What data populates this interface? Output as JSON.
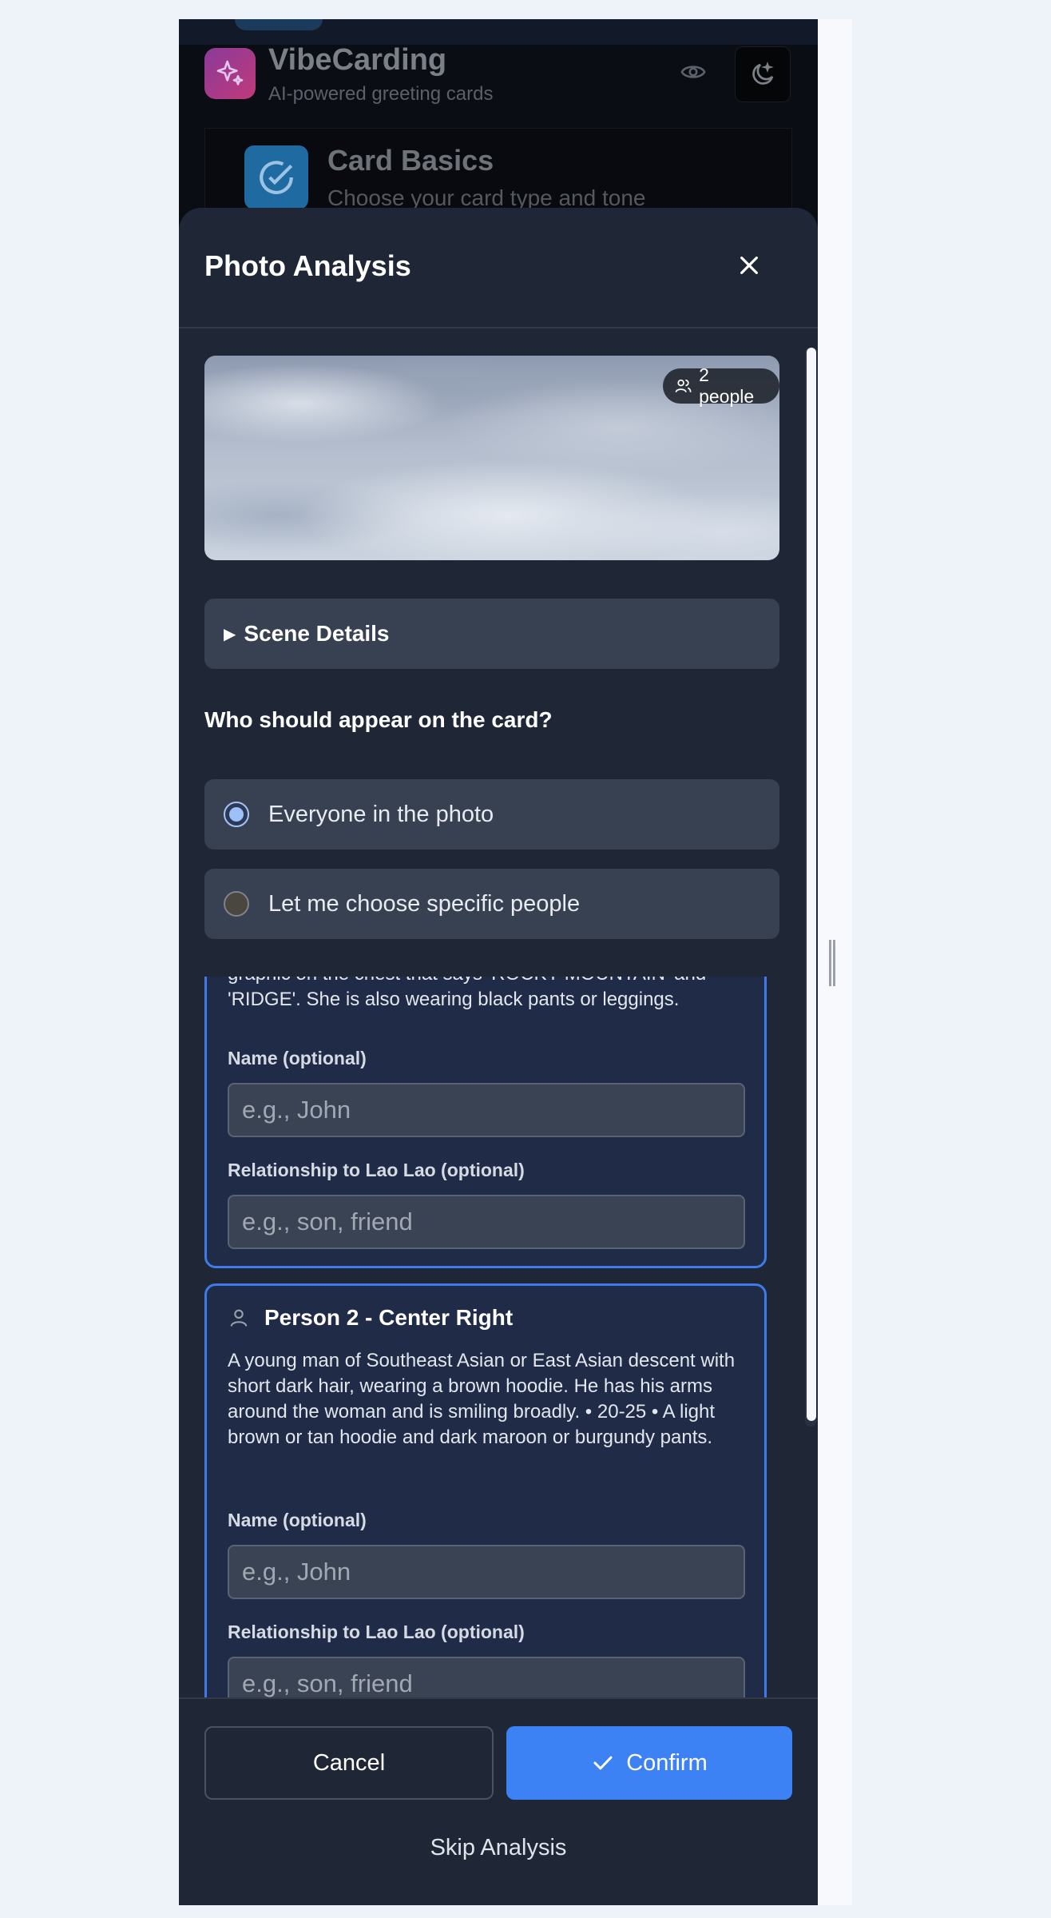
{
  "header": {
    "app_name": "VibeCarding",
    "tagline": "AI-powered greeting cards",
    "icons": [
      "sparkles-icon",
      "eye-icon",
      "moon-icon"
    ]
  },
  "background_section": {
    "title": "Card Basics",
    "subtitle": "Choose your card type and tone",
    "icon": "check-circle-icon"
  },
  "modal": {
    "title": "Photo Analysis",
    "people_badge": "2 people",
    "scene_details": "Scene Details",
    "who_question": "Who should appear on the card?",
    "options": [
      {
        "label": "Everyone in the photo",
        "selected": true
      },
      {
        "label": "Let me choose specific people",
        "selected": false
      }
    ],
    "people": [
      {
        "title": "",
        "description_visible": "graphic on the chest that says 'ROCKY MOUNTAIN' and 'RIDGE'. She is also wearing black pants or leggings.",
        "name_label": "Name (optional)",
        "name_placeholder": "e.g., John",
        "relationship_label": "Relationship to Lao Lao (optional)",
        "relationship_placeholder": "e.g., son, friend"
      },
      {
        "title": "Person 2 - Center Right",
        "description_visible": "A young man of Southeast Asian or East Asian descent with short dark hair, wearing a brown hoodie. He has his arms around the woman and is smiling broadly. • 20-25 • A light brown or tan hoodie and dark maroon or burgundy pants.",
        "name_label": "Name (optional)",
        "name_placeholder": "e.g., John",
        "relationship_label": "Relationship to Lao Lao (optional)",
        "relationship_placeholder": "e.g., son, friend"
      }
    ],
    "cancel_label": "Cancel",
    "confirm_label": "Confirm",
    "skip_label": "Skip Analysis"
  },
  "colors": {
    "accent": "#3d82f5",
    "modal_bg": "#1f2736",
    "person_card_border": "#3f7ae8"
  }
}
